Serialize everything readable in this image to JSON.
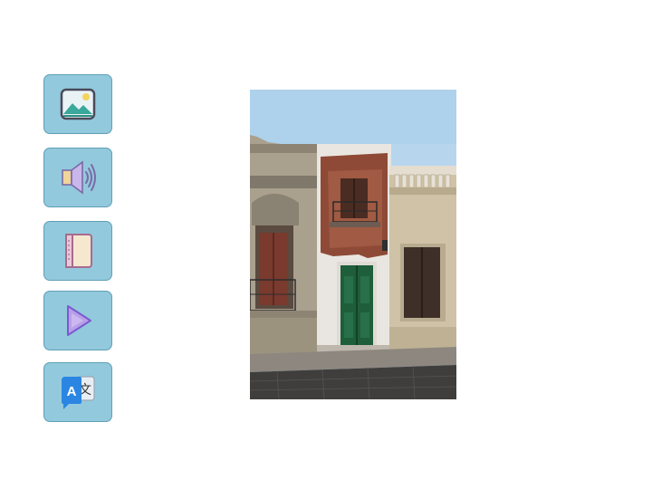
{
  "toolbar": {
    "buttons": [
      {
        "id": "image",
        "icon": "image-icon"
      },
      {
        "id": "audio",
        "icon": "speaker-icon"
      },
      {
        "id": "notebook",
        "icon": "notebook-icon"
      },
      {
        "id": "play",
        "icon": "play-icon"
      },
      {
        "id": "translate",
        "icon": "translate-icon",
        "glyph_left": "A",
        "glyph_right": "文"
      }
    ]
  },
  "colors": {
    "button_fill": "#93c9dc",
    "button_border": "#5f9fb7",
    "sky": "#b7d6ee",
    "door": "#1f5e3a"
  }
}
